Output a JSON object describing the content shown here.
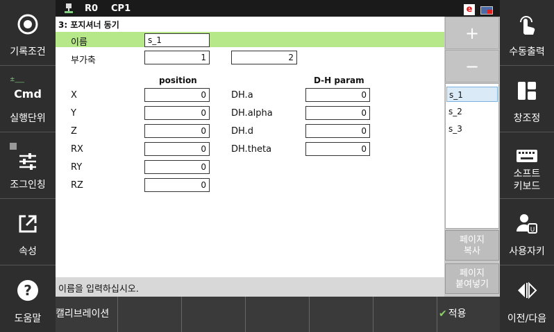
{
  "left_buttons": [
    {
      "label": "기록조건",
      "icon": "record-condition-icon"
    },
    {
      "label": "실행단위",
      "icon": "cmd-icon",
      "text": "Cmd",
      "indicator": "±___"
    },
    {
      "label": "조그인칭",
      "icon": "jog-inching-icon"
    },
    {
      "label": "속성",
      "icon": "property-icon"
    },
    {
      "label": "도움말",
      "icon": "help-icon"
    }
  ],
  "right_buttons": [
    {
      "label": "수동출력",
      "icon": "manual-output-icon"
    },
    {
      "label": "창조정",
      "icon": "window-adjust-icon"
    },
    {
      "label_line1": "소프트",
      "label_line2": "키보드",
      "icon": "soft-keyboard-icon"
    },
    {
      "label": "사용자키",
      "icon": "user-key-icon"
    },
    {
      "label": "이전/다음",
      "icon": "prev-next-icon"
    }
  ],
  "status": {
    "robot_state": "R0",
    "program": "CP1",
    "badge": "e"
  },
  "panel": {
    "title": "3: 포지셔너 동기",
    "name_label": "이름",
    "name_value": "s_1",
    "aux_label": "부가축",
    "aux_value1": "1",
    "aux_value2": "2",
    "position_header": "position",
    "dh_header": "D-H param",
    "position_rows": [
      {
        "label": "X",
        "value": "0"
      },
      {
        "label": "Y",
        "value": "0"
      },
      {
        "label": "Z",
        "value": "0"
      },
      {
        "label": "RX",
        "value": "0"
      },
      {
        "label": "RY",
        "value": "0"
      },
      {
        "label": "RZ",
        "value": "0"
      }
    ],
    "dh_rows": [
      {
        "label": "DH.a",
        "value": "0"
      },
      {
        "label": "DH.alpha",
        "value": "0"
      },
      {
        "label": "DH.d",
        "value": "0"
      },
      {
        "label": "DH.theta",
        "value": "0"
      }
    ],
    "message": "이름을 입력하십시오."
  },
  "side_panel": {
    "add": "+",
    "remove": "−",
    "items": [
      "s_1",
      "s_2",
      "s_3"
    ],
    "selected": "s_1",
    "copy_line1": "페이지",
    "copy_line2": "복사",
    "paste_line1": "페이지",
    "paste_line2": "붙여넣기"
  },
  "function_bar": {
    "f1": "캘리브레이션",
    "apply": "적용"
  },
  "colors": {
    "name_row": "#b6e88a",
    "selected_item": "#dbeaf7",
    "background": "#2e2e2e"
  }
}
